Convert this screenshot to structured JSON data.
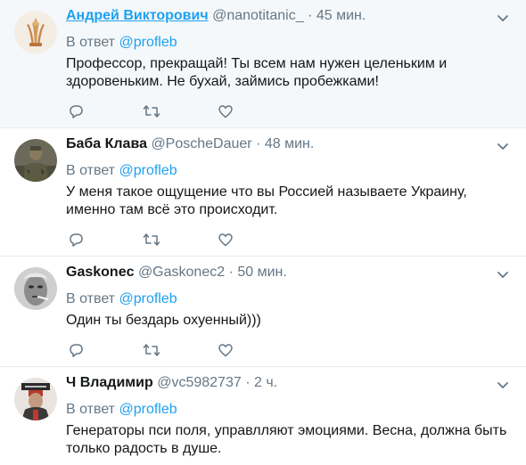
{
  "tweets": [
    {
      "name": "Андрей Викторович",
      "handle": "@nanotitanic_",
      "dot": "·",
      "time": "45 мин.",
      "reply_prefix": "В ответ",
      "reply_to": "@profleb",
      "text": "Профессор, прекращай! Ты всем нам нужен целеньким и здоровеньким. Не бухай, займись пробежками!"
    },
    {
      "name": "Баба Клава",
      "handle": "@PoscheDauer",
      "dot": "·",
      "time": "48 мин.",
      "reply_prefix": "В ответ",
      "reply_to": "@profleb",
      "text": "У меня такое ощущение что вы Россией называете Украину, именно там всё это происходит."
    },
    {
      "name": "Gaskonec",
      "handle": "@Gaskonec2",
      "dot": "·",
      "time": "50 мин.",
      "reply_prefix": "В ответ",
      "reply_to": "@profleb",
      "text": "Один ты бездарь охуенный)))"
    },
    {
      "name": "Ч Владимир",
      "handle": "@vc5982737",
      "dot": "·",
      "time": "2 ч.",
      "reply_prefix": "В ответ",
      "reply_to": "@profleb",
      "text": "Генераторы пси поля, управлляют эмоциями. Весна, должна быть только радость в душе."
    }
  ],
  "colors": {
    "accent": "#1da1f2",
    "muted": "#657786",
    "text": "#14171a",
    "highlight_bg": "#f5f8fa",
    "divider": "#e6ecf0"
  },
  "icons": [
    "reply-icon",
    "retweet-icon",
    "like-icon",
    "chevron-down-icon"
  ]
}
